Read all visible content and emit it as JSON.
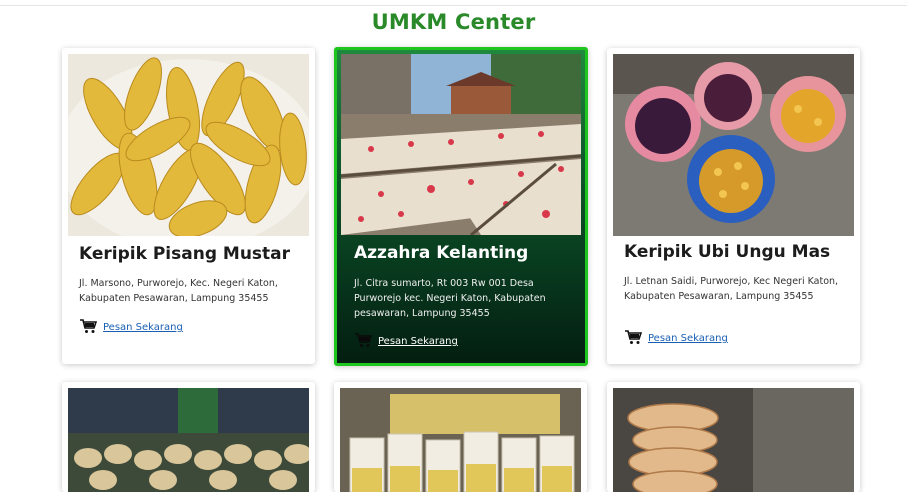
{
  "page": {
    "title": "UMKM Center"
  },
  "colors": {
    "accent": "#2a8a2a",
    "featured_border": "#1ec51e",
    "link": "#1a5fb4"
  },
  "cards": [
    {
      "title": "Keripik Pisang Mustar",
      "address": "Jl. Marsono, Purworejo, Kec. Negeri Katon, Kabupaten Pesawaran, Lampung 35455",
      "order_label": "Pesan Sekarang",
      "icon": "cart-icon"
    },
    {
      "title": "Azzahra Kelanting",
      "address": "Jl. Citra sumarto, Rt 003 Rw 001 Desa Purworejo kec. Negeri Katon, Kabupaten pesawaran, Lampung 35455",
      "order_label": "Pesan Sekarang",
      "icon": "cart-icon"
    },
    {
      "title": "Keripik Ubi Ungu Mas",
      "address": "Jl. Letnan Saidi, Purworejo, Kec Negeri Katon, Kabupaten Pesawaran, Lampung 35455",
      "order_label": "Pesan Sekarang",
      "icon": "cart-icon"
    }
  ]
}
